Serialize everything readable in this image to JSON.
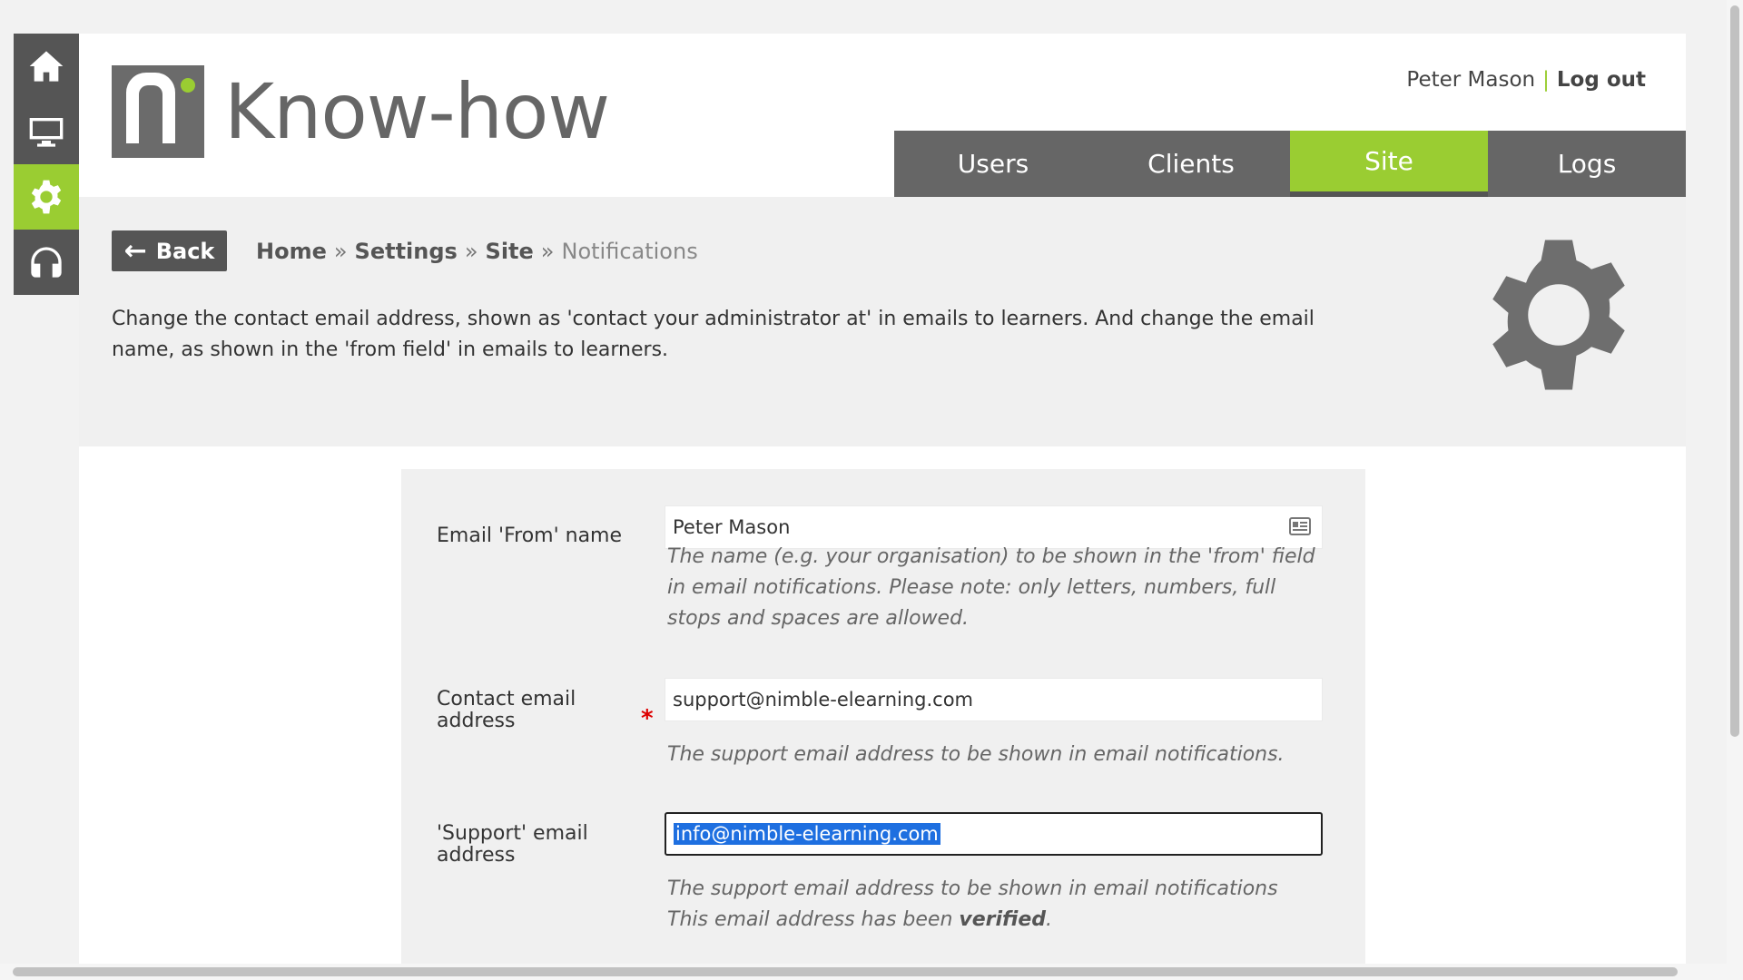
{
  "app": {
    "brand": "Know-how",
    "colors": {
      "accent": "#9acd32",
      "dark": "#555555",
      "nav": "#666666"
    }
  },
  "rail": {
    "items": [
      {
        "name": "home",
        "icon": "home-icon",
        "active": false
      },
      {
        "name": "monitor",
        "icon": "monitor-icon",
        "active": false
      },
      {
        "name": "settings",
        "icon": "gear-icon",
        "active": true
      },
      {
        "name": "support",
        "icon": "headset-icon",
        "active": false
      }
    ]
  },
  "userbar": {
    "user_name": "Peter Mason",
    "separator": "|",
    "logout_label": "Log out"
  },
  "nav": {
    "tabs": [
      {
        "label": "Users",
        "active": false
      },
      {
        "label": "Clients",
        "active": false
      },
      {
        "label": "Site",
        "active": true
      },
      {
        "label": "Logs",
        "active": false
      }
    ]
  },
  "intro": {
    "back_label": "Back",
    "breadcrumb": [
      "Home",
      "Settings",
      "Site",
      "Notifications"
    ],
    "breadcrumb_sep": "»",
    "description": "Change the contact email address, shown as 'contact your administrator at' in emails to learners. And change the email name, as shown in the 'from field' in emails to learners."
  },
  "form": {
    "from_name": {
      "label": "Email 'From' name",
      "value": "Peter Mason",
      "help": "The name (e.g. your organisation) to be shown in the 'from' field in email notifications. Please note: only letters, numbers, full stops and spaces are allowed."
    },
    "contact_email": {
      "label": "Contact email address",
      "required_mark": "*",
      "value": "support@nimble-elearning.com",
      "help": "The support email address to be shown in email notifications."
    },
    "support_email": {
      "label": "'Support' email address",
      "value": "info@nimble-elearning.com",
      "help": "The support email address to be shown in email notifications",
      "verified_prefix": "This email address has been",
      "verified_word": "verified",
      "verified_suffix": "."
    }
  }
}
